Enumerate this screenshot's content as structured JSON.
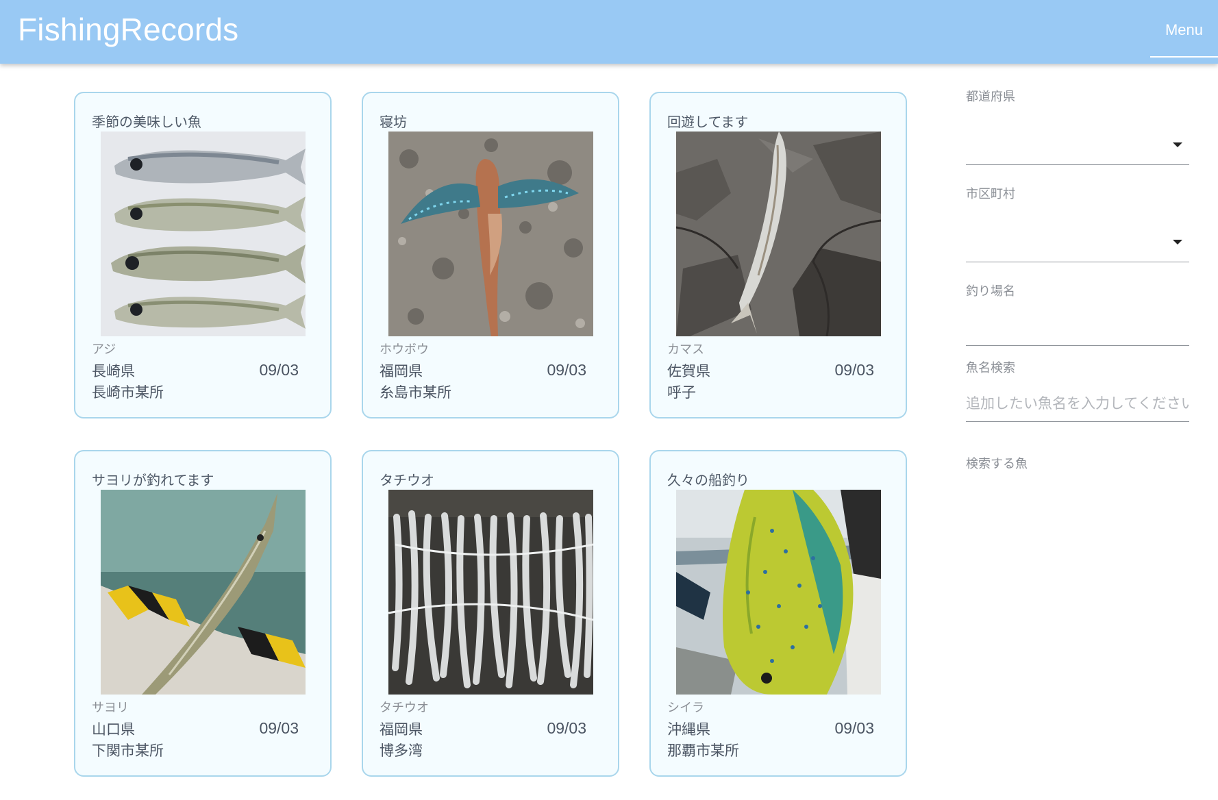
{
  "app": {
    "title": "FishingRecords",
    "menu_label": "Menu"
  },
  "records": [
    {
      "title": "季節の美味しい魚",
      "fish": "アジ",
      "prefecture": "長崎県",
      "city": "長崎市某所",
      "date": "09/03",
      "photo": "horse-mackerel-photo"
    },
    {
      "title": "寝坊",
      "fish": "ホウボウ",
      "prefecture": "福岡県",
      "city": "糸島市某所",
      "date": "09/03",
      "photo": "gurnard-photo"
    },
    {
      "title": "回遊してます",
      "fish": "カマス",
      "prefecture": "佐賀県",
      "city": "呼子",
      "date": "09/03",
      "photo": "barracuda-photo"
    },
    {
      "title": "サヨリが釣れてます",
      "fish": "サヨリ",
      "prefecture": "山口県",
      "city": "下関市某所",
      "date": "09/03",
      "photo": "halfbeak-photo"
    },
    {
      "title": "タチウオ",
      "fish": "タチウオ",
      "prefecture": "福岡県",
      "city": "博多湾",
      "date": "09/03",
      "photo": "hairtail-photo"
    },
    {
      "title": "久々の船釣り",
      "fish": "シイラ",
      "prefecture": "沖縄県",
      "city": "那覇市某所",
      "date": "09/03",
      "photo": "mahi-mahi-photo"
    }
  ],
  "filters": {
    "prefecture_label": "都道府県",
    "prefecture_value": "",
    "city_label": "市区町村",
    "city_value": "",
    "spot_label": "釣り場名",
    "spot_value": "",
    "fish_search_label": "魚名検索",
    "fish_search_placeholder": "追加したい魚名を入力してください",
    "selected_fish_label": "検索する魚"
  },
  "colors": {
    "app_bar": "#99c9f4",
    "card_border": "#a9d6ec",
    "card_bg": "#f4fcff"
  }
}
